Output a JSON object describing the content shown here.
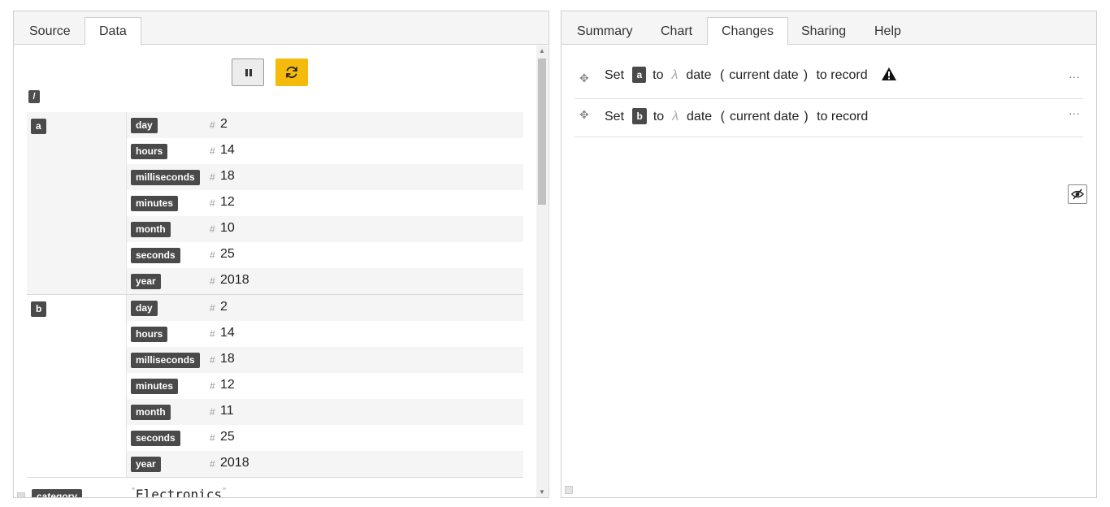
{
  "left_tabs": [
    {
      "label": "Source"
    },
    {
      "label": "Data"
    }
  ],
  "right_tabs": [
    {
      "label": "Summary"
    },
    {
      "label": "Chart"
    },
    {
      "label": "Changes"
    },
    {
      "label": "Sharing"
    },
    {
      "label": "Help"
    }
  ],
  "data": {
    "root_label": "/",
    "groups": [
      {
        "key": "a",
        "fields": [
          {
            "name": "day",
            "value": "2"
          },
          {
            "name": "hours",
            "value": "14"
          },
          {
            "name": "milliseconds",
            "value": "18"
          },
          {
            "name": "minutes",
            "value": "12"
          },
          {
            "name": "month",
            "value": "10"
          },
          {
            "name": "seconds",
            "value": "25"
          },
          {
            "name": "year",
            "value": "2018"
          }
        ]
      },
      {
        "key": "b",
        "fields": [
          {
            "name": "day",
            "value": "2"
          },
          {
            "name": "hours",
            "value": "14"
          },
          {
            "name": "milliseconds",
            "value": "18"
          },
          {
            "name": "minutes",
            "value": "12"
          },
          {
            "name": "month",
            "value": "11"
          },
          {
            "name": "seconds",
            "value": "25"
          },
          {
            "name": "year",
            "value": "2018"
          }
        ]
      }
    ],
    "number_marker": "#",
    "category": {
      "key": "category",
      "value": "Electronics"
    }
  },
  "changes": {
    "items": [
      {
        "set": "Set",
        "var": "a",
        "to": "to",
        "lambda": "λ",
        "fn": "date",
        "open": "(",
        "arg": "current date",
        "close": ")",
        "suffix": "to record",
        "warning": true
      },
      {
        "set": "Set",
        "var": "b",
        "to": "to",
        "lambda": "λ",
        "fn": "date",
        "open": "(",
        "arg": "current date",
        "close": ")",
        "suffix": "to record",
        "warning": false
      }
    ],
    "menu_glyph": "···"
  },
  "colors": {
    "refresh_button": "#f5bb0c",
    "badge": "#4a4a4a"
  }
}
